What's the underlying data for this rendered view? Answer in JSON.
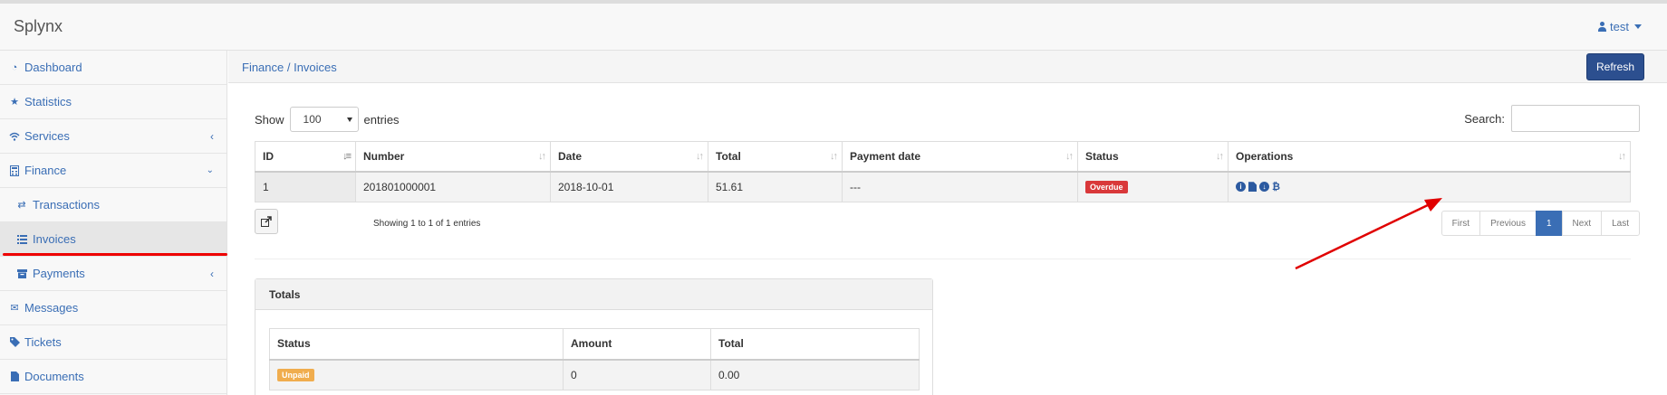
{
  "app": {
    "brand": "Splynx",
    "user": "test"
  },
  "sidebar": {
    "items": [
      {
        "label": "Dashboard"
      },
      {
        "label": "Statistics"
      },
      {
        "label": "Services"
      },
      {
        "label": "Finance"
      },
      {
        "label": "Transactions"
      },
      {
        "label": "Invoices"
      },
      {
        "label": "Payments"
      },
      {
        "label": "Messages"
      },
      {
        "label": "Tickets"
      },
      {
        "label": "Documents"
      }
    ]
  },
  "header": {
    "breadcrumb": "Finance / Invoices",
    "refresh_label": "Refresh"
  },
  "table_controls": {
    "show_label": "Show",
    "page_length": "100",
    "entries_label": "entries",
    "search_label": "Search:"
  },
  "invoices": {
    "columns": [
      "ID",
      "Number",
      "Date",
      "Total",
      "Payment date",
      "Status",
      "Operations"
    ],
    "rows": [
      {
        "id": "1",
        "number": "201801000001",
        "date": "2018-10-01",
        "total": "51.61",
        "payment_date": "---",
        "status": "Overdue"
      }
    ],
    "info": "Showing 1 to 1 of 1 entries"
  },
  "pagination": {
    "first": "First",
    "previous": "Previous",
    "current": "1",
    "next": "Next",
    "last": "Last"
  },
  "totals": {
    "title": "Totals",
    "columns": [
      "Status",
      "Amount",
      "Total"
    ],
    "rows": [
      {
        "status": "Unpaid",
        "amount": "0",
        "total": "0.00"
      }
    ]
  },
  "colors": {
    "link": "#3a6eb5",
    "primary_button": "#2c4f8f",
    "overdue": "#d9383a",
    "unpaid": "#f0ad4e",
    "annotation": "#e00000"
  },
  "icons": {
    "operations": [
      "info-icon",
      "document-icon",
      "download-icon",
      "bitcoin-icon"
    ]
  }
}
